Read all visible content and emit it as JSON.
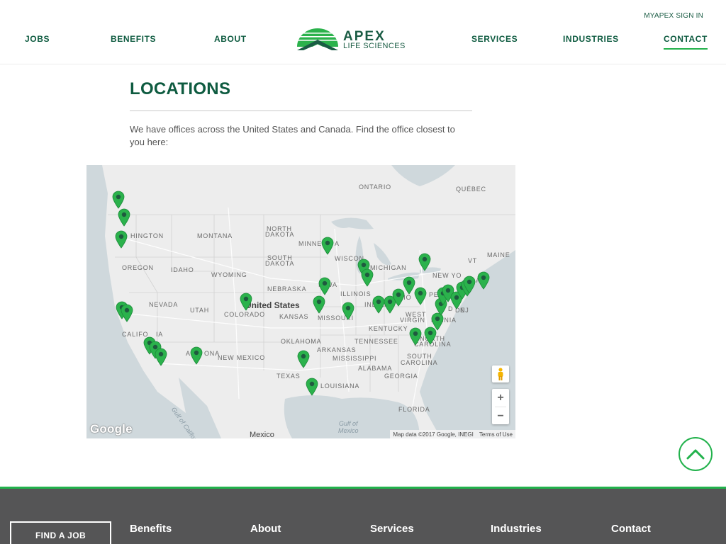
{
  "header": {
    "signin_label": "MYAPEX SIGN IN",
    "nav_left": [
      {
        "label": "JOBS"
      },
      {
        "label": "BENEFITS"
      },
      {
        "label": "ABOUT"
      }
    ],
    "nav_right": [
      {
        "label": "SERVICES"
      },
      {
        "label": "INDUSTRIES"
      },
      {
        "label": "CONTACT",
        "active": true
      }
    ],
    "logo": {
      "word": "APEX",
      "subtitle": "LIFE SCIENCES",
      "icon": "apex-mountain-logo"
    }
  },
  "main": {
    "title": "LOCATIONS",
    "intro": "We have offices across the United States and Canada. Find the office closest to you here:"
  },
  "map": {
    "country_label": "United States",
    "labels": {
      "ontario": "ONTARIO",
      "quebec": "QUÉBEC",
      "washington": "HINGTON",
      "montana": "MONTANA",
      "north_dakota_1": "NORTH",
      "north_dakota_2": "DAKOTA",
      "minnesota": "MINNES",
      "minnesota_tail": "A",
      "oregon": "OREGON",
      "idaho": "IDAHO",
      "wyoming": "WYOMING",
      "south_dakota_1": "SOUTH",
      "south_dakota_2": "DAKOTA",
      "wisconsin": "WISCON",
      "michigan": "MICHIGAN",
      "maine": "MAINE",
      "vermont": "VT",
      "new_york": "NEW YO",
      "iowa": "IOWA",
      "nebraska": "NEBRASKA",
      "illinois": "ILLINOIS",
      "indiana": "INDIAN",
      "ohio": "HIO",
      "penn": "PE",
      "nevada": "NEVADA",
      "utah": "UTAH",
      "colorado": "COLORADO",
      "kansas": "KANSAS",
      "missouri": "MISSOURI",
      "west_virginia": "WEST",
      "virginia": "VIRGIN",
      "virginia_tail": "RGINIA",
      "kentucky": "KENTUCKY",
      "california": "CALIFO",
      "california_tail": "IA",
      "arizona": "AR",
      "arizona_tail": "ONA",
      "new_mexico": "NEW MEXICO",
      "oklahoma": "OKLAHOMA",
      "arkansas": "ARKANSAS",
      "tennessee": "TENNESSEE",
      "north_carolina_1": "NORTH",
      "north_carolina_2": "CAROLINA",
      "mississippi": "MISSISSIPPI",
      "alabama": "ALABAMA",
      "south_carolina_1": "SOUTH",
      "south_carolina_2": "CAROLINA",
      "georgia": "GEORGIA",
      "texas": "TEXAS",
      "louisiana": "LOUISIANA",
      "florida": "FLORIDA",
      "mexico": "Mexico",
      "maryland": "D",
      "delaware": "DE",
      "new_jersey": "NJ",
      "ma": "A"
    },
    "water": {
      "gulf_of_mexico_1": "Gulf of",
      "gulf_of_mexico_2": "Mexico",
      "gulf_of_california": "Gulf of California"
    },
    "google_logo": "Google",
    "attribution": "Map data ©2017 Google, INEGI",
    "terms": "Terms of Use",
    "zoom_in": "+",
    "zoom_out": "−",
    "pin_color": "#2bb24c",
    "pin_dot_color": "#1f5a3f"
  },
  "footer": {
    "find_job_label": "FIND A JOB",
    "links": [
      {
        "label": "Benefits"
      },
      {
        "label": "About"
      },
      {
        "label": "Services"
      },
      {
        "label": "Industries"
      },
      {
        "label": "Contact"
      }
    ]
  },
  "colors": {
    "brand_green": "#0e5b40",
    "accent_green": "#22b24c",
    "footer_gray": "#555556"
  }
}
